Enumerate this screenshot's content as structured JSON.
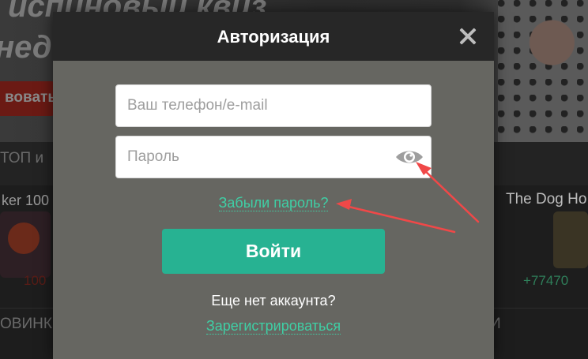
{
  "background": {
    "banner_title_line1": "испиновый квиз",
    "banner_title_line2": "нед",
    "banner_button_fragment": "вовать",
    "section_top_fragment": "ТОП и",
    "game_left_fragment": "ker 100",
    "game_right_title": "The Dog Ho",
    "game_right_count": "+77470",
    "game_left_count": "100",
    "section_new_fragment": "ОВИНК",
    "section_new_right_fragment": "И"
  },
  "modal": {
    "title": "Авторизация",
    "login_placeholder": "Ваш телефон/e-mail",
    "login_value": "",
    "password_placeholder": "Пароль",
    "password_value": "",
    "forgot_link": "Забыли пароль?",
    "submit_label": "Войти",
    "no_account_text": "Еще нет аккаунта?",
    "register_link": "Зарегистрироваться"
  },
  "icons": {
    "close": "close-icon",
    "eye": "eye-icon"
  },
  "colors": {
    "accent": "#27b292",
    "link": "#3fcfa5",
    "modal_header": "#272727",
    "modal_body": "#666661",
    "annotation_arrow": "#f04848"
  }
}
